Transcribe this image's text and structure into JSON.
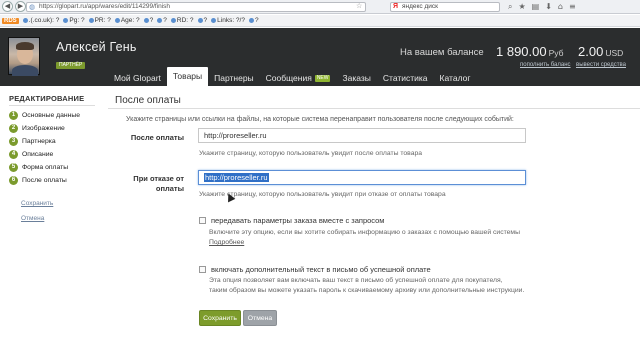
{
  "browser": {
    "url": "https://glopart.ru/app/wares/edit/114299/finish",
    "search_text": "яндекс диск",
    "back_label": "◀",
    "fwd_label": "▶"
  },
  "seo_bar": {
    "rds": "RDS",
    "items": [
      {
        "label": ".(.co.uk): ?"
      },
      {
        "label": "Pg: ?"
      },
      {
        "label": "PR: ?"
      },
      {
        "label": "Age: ?"
      },
      {
        "label": "?"
      },
      {
        "label": "?"
      },
      {
        "label": "RD: ?"
      },
      {
        "label": "?"
      },
      {
        "label": "Links: ?/?"
      },
      {
        "label": "?"
      }
    ]
  },
  "header": {
    "user_name": "Алексей Гень",
    "user_badge": "ПАРТНЁР",
    "balance_label": "На вашем балансе",
    "balance_rub": "1 890.00",
    "balance_rub_currency": "Руб",
    "balance_usd": "2.00",
    "balance_usd_currency": "USD",
    "topup_link": "пополнить баланс",
    "withdraw_link": "вывести средства"
  },
  "nav": {
    "tabs": [
      {
        "label": "Мой Glopart"
      },
      {
        "label": "Товары"
      },
      {
        "label": "Партнеры"
      },
      {
        "label": "Сообщения"
      },
      {
        "label": "Заказы"
      },
      {
        "label": "Статистика"
      },
      {
        "label": "Каталог"
      }
    ],
    "messages_badge": "NEW",
    "active_tab": "Товары"
  },
  "sidebar": {
    "title": "РЕДАКТИРОВАНИЕ",
    "steps": [
      {
        "num": "1",
        "label": "Основные данные"
      },
      {
        "num": "2",
        "label": "Изображение"
      },
      {
        "num": "3",
        "label": "Партнерка"
      },
      {
        "num": "4",
        "label": "Описание"
      },
      {
        "num": "5",
        "label": "Форма оплаты"
      },
      {
        "num": "6",
        "label": "После оплаты"
      }
    ],
    "save_link": "Сохранить",
    "cancel_link": "Отмена"
  },
  "main": {
    "section_title": "После оплаты",
    "intro": "Укажите страницы или ссылки на файлы, на которые система перенаправит пользователя после следующих событий:",
    "after_payment_label": "После оплаты",
    "after_payment_value": "http://proreseller.ru",
    "after_payment_hint": "Укажите страницу, которую пользователь увидит после оплаты товара",
    "on_refusal_label": "При отказе от оплаты",
    "on_refusal_label_line1": "При отказе от",
    "on_refusal_label_line2": "оплаты",
    "on_refusal_value": "http://proreseller.ru",
    "on_refusal_hint": "Укажите страницу, которую пользователь увидит при отказе от оплаты товара",
    "pass_params_label": "передавать параметры заказа вместе с запросом",
    "pass_params_checked": false,
    "pass_params_desc": "Включите эту опцию, если вы хотите собирать информацию о заказах с помощью вашей системы",
    "pass_params_more": "Подробнее",
    "extra_text_label": "включать дополнительный текст в письмо об успешной оплате",
    "extra_text_checked": false,
    "extra_text_desc_line1": "Эта опция позволяет вам включать ваш текст в письмо об успешной оплате для покупателя,",
    "extra_text_desc_line2": "таким образом вы можете указать пароль к скачиваемому архиву или дополнительные инструкции.",
    "save_button": "Сохранить",
    "cancel_button": "Отмена"
  }
}
